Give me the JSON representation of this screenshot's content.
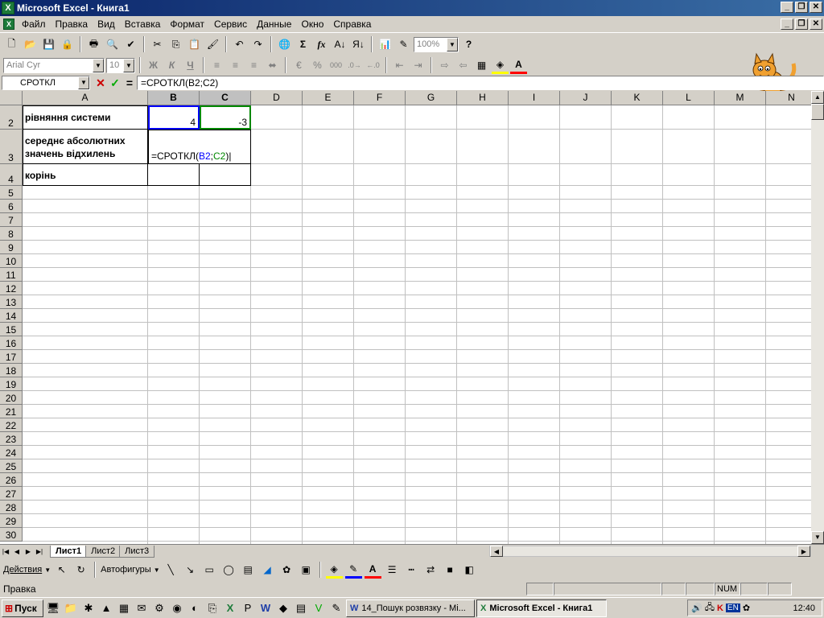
{
  "window": {
    "title": "Microsoft Excel - Книга1"
  },
  "menu": {
    "items": [
      "Файл",
      "Правка",
      "Вид",
      "Вставка",
      "Формат",
      "Сервис",
      "Данные",
      "Окно",
      "Справка"
    ]
  },
  "toolbar": {
    "zoom": "100%",
    "font_name": "Arial Cyr",
    "font_size": "10",
    "bold": "Ж",
    "italic": "К",
    "underline": "Ч",
    "sum": "Σ",
    "fx": "fx",
    "percent": "%",
    "thousands": "000"
  },
  "formula_bar": {
    "name_box": "СРОТКЛ",
    "cancel": "✕",
    "enter": "✓",
    "equals": "=",
    "formula": "=СРОТКЛ(B2;C2)"
  },
  "columns": [
    "A",
    "B",
    "C",
    "D",
    "E",
    "F",
    "G",
    "H",
    "I",
    "J",
    "K",
    "L",
    "M",
    "N"
  ],
  "rows": [
    "2",
    "3",
    "4",
    "5",
    "6",
    "7",
    "8",
    "9",
    "10",
    "11",
    "12",
    "13",
    "14",
    "15",
    "16",
    "17",
    "18",
    "19",
    "20",
    "21",
    "22",
    "23",
    "24",
    "25",
    "26",
    "27",
    "28",
    "29",
    "30"
  ],
  "cells": {
    "A2": "рівняння системи",
    "B2": "4",
    "C2": "-3",
    "A3": "середнє абсолютних значень відхилень",
    "B3_prefix": "=СРОТКЛ(",
    "B3_ref1": "B2",
    "B3_sep": ";",
    "B3_ref2": "C2",
    "B3_suffix": ")",
    "A4": "корінь"
  },
  "sheets": [
    "Лист1",
    "Лист2",
    "Лист3"
  ],
  "drawing_toolbar": {
    "actions": "Действия",
    "autoshapes": "Автофигуры"
  },
  "status": {
    "mode": "Правка",
    "num": "NUM"
  },
  "taskbar": {
    "start": "Пуск",
    "tasks": [
      "14_Пошук розвязку - Mi...",
      "Microsoft Excel - Книга1"
    ],
    "lang": "EN",
    "clock": "12:40"
  }
}
